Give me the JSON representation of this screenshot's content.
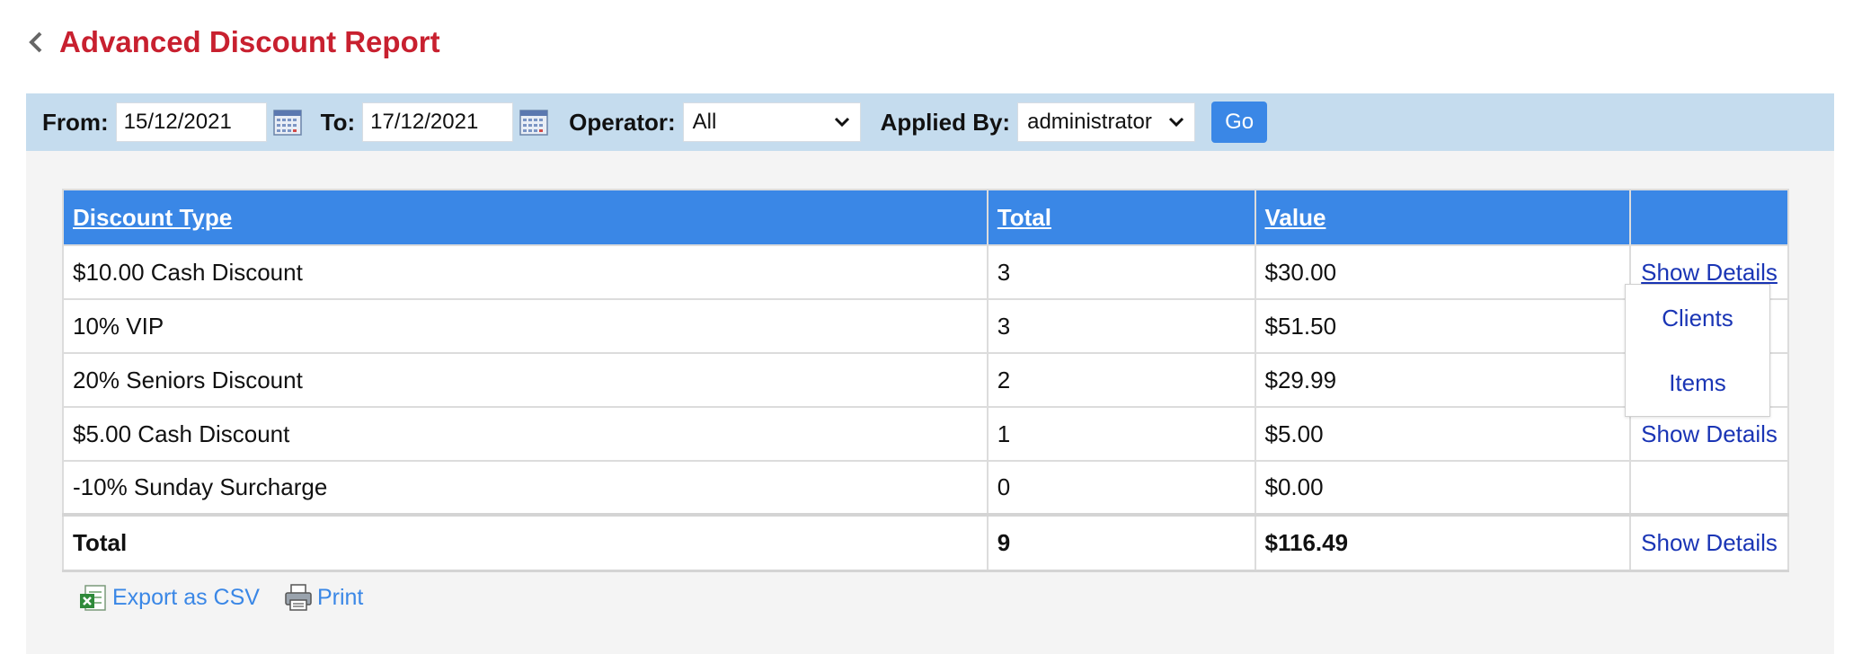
{
  "page": {
    "title": "Advanced Discount Report"
  },
  "filters": {
    "from_label": "From:",
    "from_value": "15/12/2021",
    "to_label": "To:",
    "to_value": "17/12/2021",
    "operator_label": "Operator:",
    "operator_value": "All",
    "applied_by_label": "Applied By:",
    "applied_by_value": "administrator",
    "go_label": "Go"
  },
  "table": {
    "headers": {
      "type": "Discount Type",
      "total": "Total",
      "value": "Value",
      "action": ""
    },
    "rows": [
      {
        "type": "$10.00 Cash Discount",
        "total": "3",
        "value": "$30.00",
        "action": "Show Details"
      },
      {
        "type": "10% VIP",
        "total": "3",
        "value": "$51.50",
        "action": ""
      },
      {
        "type": "20% Seniors Discount",
        "total": "2",
        "value": "$29.99",
        "action": ""
      },
      {
        "type": "$5.00 Cash Discount",
        "total": "1",
        "value": "$5.00",
        "action": "Show Details"
      },
      {
        "type": "-10% Sunday Surcharge",
        "total": "0",
        "value": "$0.00",
        "action": ""
      }
    ],
    "total_row": {
      "label": "Total",
      "total": "9",
      "value": "$116.49",
      "action": "Show Details"
    }
  },
  "details_menu": {
    "items": [
      "Clients",
      "Items"
    ]
  },
  "footer": {
    "export_label": "Export as CSV",
    "print_label": "Print"
  },
  "colors": {
    "title": "#c8202f",
    "filter_bar": "#c5dcee",
    "header": "#3a87e6",
    "link": "#1a35b5"
  }
}
